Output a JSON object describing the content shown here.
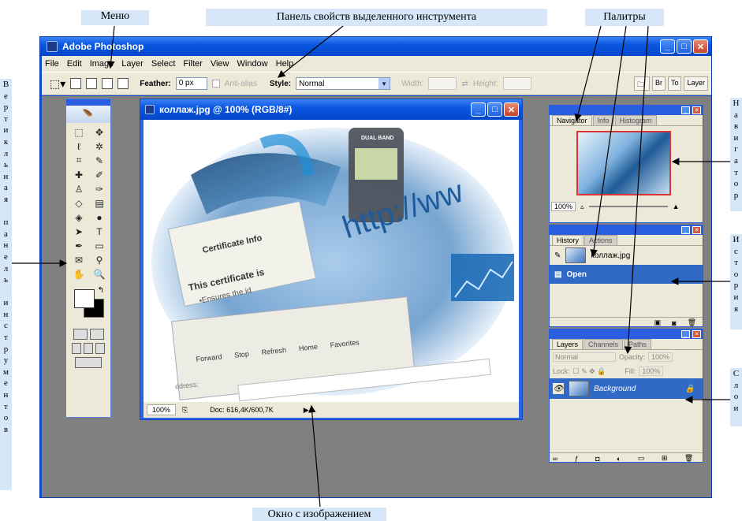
{
  "annotations": {
    "menu": "Меню",
    "options_bar": "Панель свойств выделенного инструмента",
    "palettes": "Палитры",
    "image_window": "Окно с изображением",
    "toolbox_vertical": [
      "В",
      "е",
      "р",
      "т",
      "и",
      "к",
      "л",
      "ь",
      "н",
      "а",
      "я",
      "",
      "п",
      "а",
      "н",
      "е",
      "л",
      "ь",
      "",
      "и",
      "н",
      "с",
      "т",
      "р",
      "у",
      "м",
      "е",
      "н",
      "т",
      "о",
      "в"
    ],
    "navigator_vertical": [
      "Н",
      "а",
      "в",
      "и",
      "г",
      "а",
      "т",
      "о",
      "р"
    ],
    "history_vertical": [
      "И",
      "с",
      "т",
      "о",
      "р",
      "и",
      "я"
    ],
    "layers_vertical": [
      "С",
      "л",
      "о",
      "и"
    ]
  },
  "app": {
    "title": "Adobe Photoshop",
    "menu": [
      "File",
      "Edit",
      "Image",
      "Layer",
      "Select",
      "Filter",
      "View",
      "Window",
      "Help"
    ]
  },
  "options_bar": {
    "feather_label": "Feather:",
    "feather_value": "0 px",
    "antialias_label": "Anti-alias",
    "style_label": "Style:",
    "style_value": "Normal",
    "width_label": "Width:",
    "height_label": "Height:",
    "mini_tabs": [
      "Br",
      "To",
      "Layer"
    ]
  },
  "document": {
    "title": "коллаж.jpg @ 100% (RGB/8#)",
    "zoom": "100%",
    "doc_size": "Doc: 616,4K/600,7K",
    "collage_text": {
      "url": "http://ww",
      "dual_band": "DUAL BAND",
      "certificate": "Certificate Info",
      "cert_line": "This certificate is",
      "ensures": "•Ensures the id",
      "browser_buttons": [
        "Forward",
        "Stop",
        "Refresh",
        "Home",
        "Favorites"
      ],
      "address": "ddress:"
    }
  },
  "navigator": {
    "tabs": [
      "Navigator",
      "Info",
      "Histogram"
    ],
    "zoom": "100%"
  },
  "history": {
    "tabs": [
      "History",
      "Actions"
    ],
    "snapshot": "коллаж.jpg",
    "state": "Open"
  },
  "layers": {
    "tabs": [
      "Layers",
      "Channels",
      "Paths"
    ],
    "blend_mode": "Normal",
    "opacity_label": "Opacity:",
    "opacity_value": "100%",
    "lock_label": "Lock:",
    "fill_label": "Fill:",
    "fill_value": "100%",
    "layer_name": "Background"
  },
  "colors": {
    "xp_blue": "#0e4fd6",
    "annotation_bg": "#d6e7f7",
    "workspace_gray": "#808080",
    "selection_blue": "#3169c6"
  }
}
